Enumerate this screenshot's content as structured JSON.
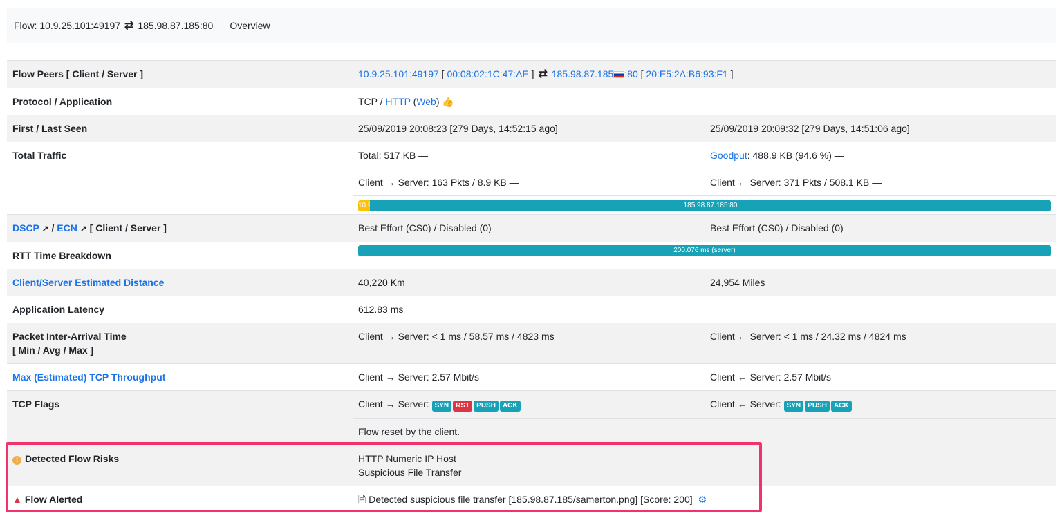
{
  "header": {
    "flow_prefix": "Flow: 10.9.25.101:49197",
    "flow_swap_icon": "⇄",
    "flow_dst": "185.98.87.185:80",
    "overview_label": "Overview"
  },
  "rows": {
    "flow_peers": {
      "label": "Flow Peers [ Client / Server ]",
      "client_ip": "10.9.25.101:49197",
      "client_mac_open": " [ ",
      "client_mac": "00:08:02:1C:47:AE",
      "client_mac_close": " ] ",
      "server_ip": "185.98.87.185",
      "server_port": ":80",
      "server_mac_open": " [ ",
      "server_mac": "20:E5:2A:B6:93:F1",
      "server_mac_close": " ]"
    },
    "protocol": {
      "label": "Protocol / Application",
      "proto": "TCP / ",
      "app": "HTTP",
      "cat_open": " (",
      "category": "Web",
      "cat_close": ")"
    },
    "seen": {
      "label": "First / Last Seen",
      "first": "25/09/2019 20:08:23 [279 Days, 14:52:15 ago]",
      "last": "25/09/2019 20:09:32 [279 Days, 14:51:06 ago]"
    },
    "traffic": {
      "label": "Total Traffic",
      "total": "Total: 517 KB —",
      "goodput_label": "Goodput",
      "goodput_value": ": 488.9 KB (94.6 %) —",
      "c2s": "Client → Server: 163 Pkts / 8.9 KB —",
      "s2c": "Client ← Server: 371 Pkts / 508.1 KB —",
      "bar_client_label": "10.9",
      "bar_server_label": "185.98.87.185:80"
    },
    "dscp": {
      "label_dscp": "DSCP",
      "label_sep": " / ",
      "label_ecn": "ECN",
      "label_suffix": " [ Client / Server ]",
      "client": "Best Effort (CS0) / Disabled (0)",
      "server": "Best Effort (CS0) / Disabled (0)"
    },
    "rtt": {
      "label": "RTT Time Breakdown",
      "bar_label": "200.076 ms (server)"
    },
    "distance": {
      "label": "Client/Server Estimated Distance",
      "km": "40,220 Km",
      "miles": "24,954 Miles"
    },
    "latency": {
      "label": "Application Latency",
      "value": "612.83 ms"
    },
    "iat": {
      "label": "Packet Inter-Arrival Time",
      "label2": "[ Min / Avg / Max ]",
      "c2s": "Client → Server: < 1 ms / 58.57 ms / 4823 ms",
      "s2c": "Client ← Server: < 1 ms / 24.32 ms / 4824 ms"
    },
    "throughput": {
      "label": "Max (Estimated) TCP Throughput",
      "c2s": "Client → Server: 2.57 Mbit/s",
      "s2c": "Client ← Server: 2.57 Mbit/s"
    },
    "tcp_flags": {
      "label": "TCP Flags",
      "c2s_prefix": "Client → Server: ",
      "c2s_flags": [
        "SYN",
        "RST",
        "PUSH",
        "ACK"
      ],
      "s2c_prefix": "Client ← Server: ",
      "s2c_flags": [
        "SYN",
        "PUSH",
        "ACK"
      ],
      "note": "Flow reset by the client."
    },
    "risks": {
      "label": "Detected Flow Risks",
      "risk1": "HTTP Numeric IP Host",
      "risk2": "Suspicious File Transfer"
    },
    "alert": {
      "label": "Flow Alerted",
      "text": "Detected suspicious file transfer [185.98.87.185/samerton.png] [Score: 200]"
    }
  },
  "progress": {
    "traffic_client_fraction": 0.017,
    "traffic_server_fraction": 0.983,
    "rtt_server_fraction": 1.0
  },
  "icons": [
    "swap-arrows-icon",
    "flag-icon",
    "thumbs-up-icon",
    "external-link-icon",
    "warning-circle-icon",
    "warning-triangle-icon",
    "file-icon",
    "gear-icon"
  ],
  "colors": {
    "link": "#1a73e8",
    "teal": "#17a2b8",
    "danger": "#dc3545",
    "highlight": "#f0336c",
    "warning": "#f0ad4e"
  }
}
